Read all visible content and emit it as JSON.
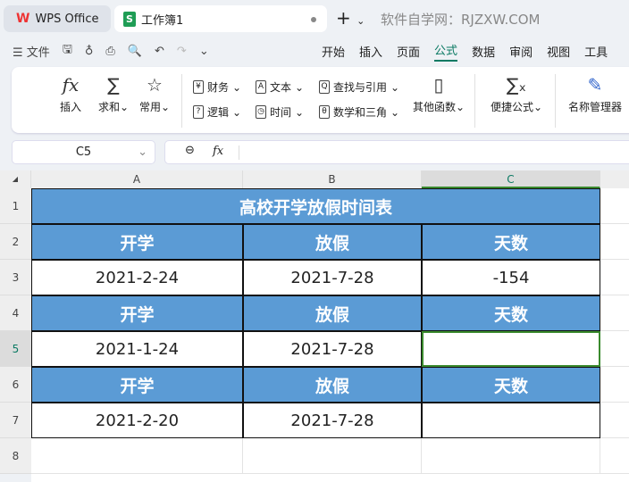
{
  "tabs": {
    "app": "WPS Office",
    "doc": "工作簿1",
    "site": "软件自学网：RJZXW.COM"
  },
  "menu": {
    "file": "文件",
    "tabs": [
      "开始",
      "插入",
      "页面",
      "公式",
      "数据",
      "审阅",
      "视图",
      "工具"
    ],
    "active": "公式"
  },
  "ribbon": {
    "insert": "插入",
    "sum": "求和",
    "common": "常用",
    "finance": "财务",
    "text": "文本",
    "lookup": "查找与引用",
    "logic": "逻辑",
    "time": "时间",
    "math": "数学和三角",
    "other": "其他函数",
    "quick": "便捷公式",
    "names": "名称管理器"
  },
  "formula_bar": {
    "cell_ref": "C5",
    "fx": "fx",
    "value": ""
  },
  "columns": [
    "A",
    "B",
    "C"
  ],
  "rows": [
    "1",
    "2",
    "3",
    "4",
    "5",
    "6",
    "7",
    "8"
  ],
  "sheet": {
    "title": "高校开学放假时间表",
    "blocks": [
      {
        "headers": [
          "开学",
          "放假",
          "天数"
        ],
        "values": [
          "2021-2-24",
          "2021-7-28",
          "-154"
        ]
      },
      {
        "headers": [
          "开学",
          "放假",
          "天数"
        ],
        "values": [
          "2021-1-24",
          "2021-7-28",
          ""
        ]
      },
      {
        "headers": [
          "开学",
          "放假",
          "天数"
        ],
        "values": [
          "2021-2-20",
          "2021-7-28",
          ""
        ]
      }
    ]
  },
  "colors": {
    "header_fill": "#5b9bd5",
    "accent": "#0b7a63",
    "selection": "#3a8a2e"
  }
}
